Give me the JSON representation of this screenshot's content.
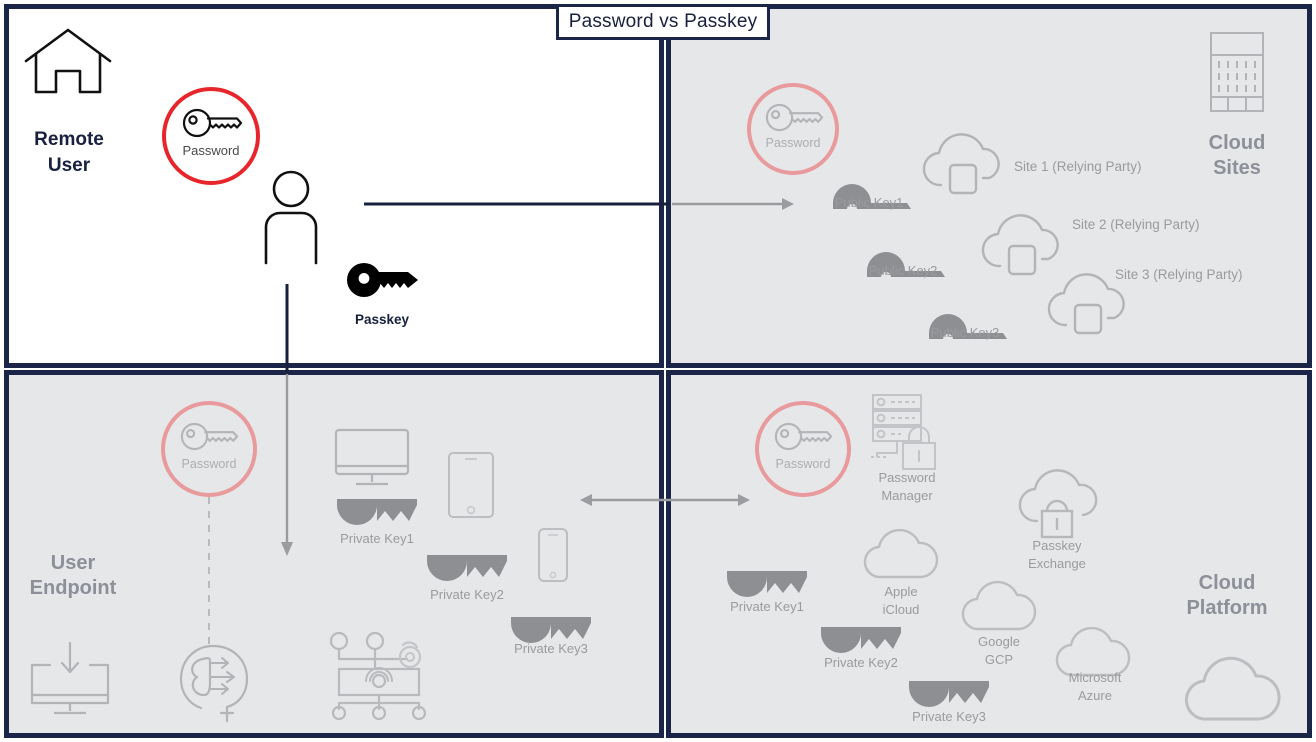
{
  "title": {
    "text": "Password vs Passkey"
  },
  "colors": {
    "frame_navy": "#1b2547",
    "panel_gray": "#e6e7e8",
    "panel_white": "#ffffff",
    "password_red": "#e8252a",
    "password_faded": "#e89a9d",
    "icon_gray": "#a9abae",
    "key_gray": "#808285",
    "label_gray": "#9b9b9e",
    "zone_label_gray": "#8d9099",
    "arrow_gray": "#9a9c9f",
    "black": "#000000"
  },
  "quadrants": {
    "top_left": {
      "name": "Remote User",
      "zone_label_lines": [
        "Remote",
        "User"
      ],
      "icons": [
        {
          "id": "home-icon",
          "label": ""
        },
        {
          "id": "person-icon",
          "label": ""
        }
      ],
      "password_badge": {
        "label": "Password",
        "state": "active"
      },
      "passkey_badge": {
        "label": "Passkey",
        "state": "active"
      }
    },
    "top_right": {
      "zone_label_lines": [
        "Cloud",
        "Sites"
      ],
      "password_badge": {
        "label": "Password",
        "state": "faded"
      },
      "public_keys": [
        "Public Key1",
        "Public Key2",
        "Public Key3"
      ],
      "sites": [
        "Site 1 (Relying Party)",
        "Site 2 (Relying Party)",
        "Site 3 (Relying Party)"
      ],
      "building_icon": "office-building-icon"
    },
    "bottom_left": {
      "zone_label_lines": [
        "User",
        "Endpoint"
      ],
      "password_badge": {
        "label": "Password",
        "state": "faded"
      },
      "private_keys": [
        "Private Key1",
        "Private Key2",
        "Private Key3"
      ],
      "devices": [
        "monitor-icon",
        "tablet-icon",
        "smartphone-icon"
      ],
      "bottom_icons": [
        "download-to-computer-icon",
        "brain-head-icon",
        "network-diagram-icon"
      ]
    },
    "bottom_right": {
      "zone_label_lines": [
        "Cloud",
        "Platform"
      ],
      "password_badge": {
        "label": "Password",
        "state": "faded"
      },
      "password_manager": {
        "lines": [
          "Password",
          "Manager"
        ]
      },
      "passkey_exchange": {
        "lines": [
          "Passkey",
          "Exchange"
        ]
      },
      "private_keys": [
        "Private Key1",
        "Private Key2",
        "Private Key3"
      ],
      "providers": [
        {
          "lines": [
            "Apple",
            "iCloud"
          ]
        },
        {
          "lines": [
            "Google",
            "GCP"
          ]
        },
        {
          "lines": [
            "Microsoft",
            "Azure"
          ]
        }
      ],
      "cloud_icon": "cloud-icon"
    }
  },
  "connectors": [
    {
      "id": "user-to-cloud-sites",
      "direction": "right",
      "style": "solid"
    },
    {
      "id": "user-to-endpoint",
      "direction": "down",
      "style": "solid"
    },
    {
      "id": "endpoint-to-cloud-platform",
      "direction": "both",
      "style": "solid"
    },
    {
      "id": "password-to-brain",
      "direction": "down",
      "style": "dashed"
    }
  ]
}
